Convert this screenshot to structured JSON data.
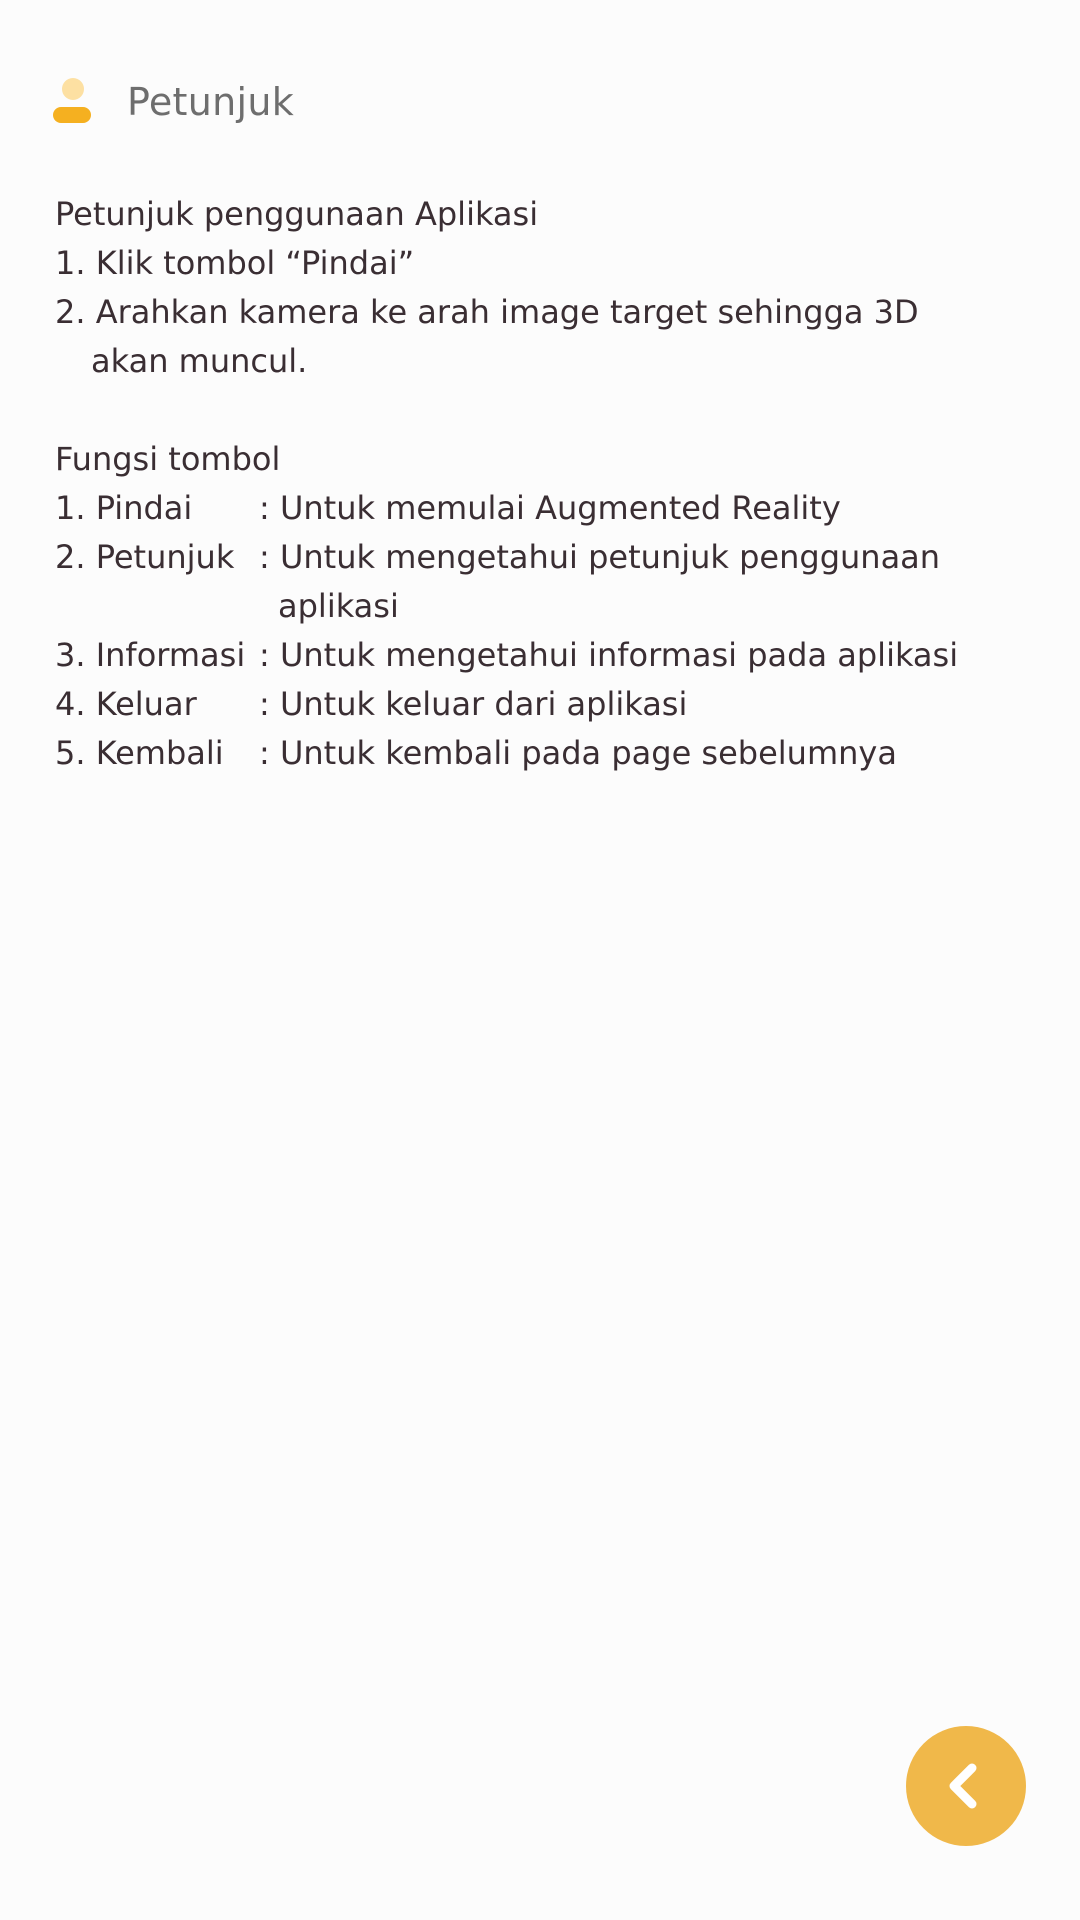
{
  "header": {
    "title": "Petunjuk",
    "icon": "user-icon",
    "icon_colors": {
      "head": "#fde0a2",
      "body": "#f5b020"
    }
  },
  "content": {
    "usage_heading": "Petunjuk penggunaan Aplikasi",
    "usage_steps": [
      "1.  Klik tombol “Pindai”",
      "2. Arahkan kamera ke arah image target sehingga 3D",
      "akan muncul."
    ],
    "buttons_heading": "Fungsi tombol",
    "buttons": [
      {
        "label": "1. Pindai",
        "desc": ": Untuk memulai Augmented Reality"
      },
      {
        "label": "2. Petunjuk",
        "desc": ": Untuk mengetahui petunjuk penggunaan",
        "desc_cont": "aplikasi"
      },
      {
        "label": "3. Informasi",
        "desc": ": Untuk mengetahui informasi pada aplikasi"
      },
      {
        "label": "4. Keluar",
        "desc": ": Untuk keluar dari aplikasi"
      },
      {
        "label": "5. Kembali",
        "desc": ": Untuk kembali pada page sebelumnya"
      }
    ]
  },
  "back_button": {
    "icon": "chevron-left-icon",
    "color": "#f0b84a"
  }
}
